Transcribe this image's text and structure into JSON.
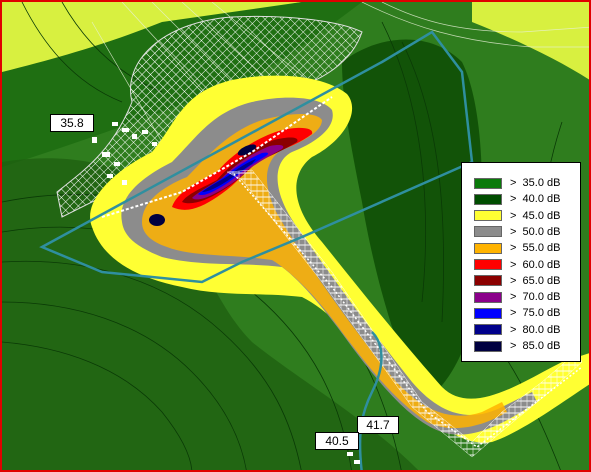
{
  "map": {
    "callouts": [
      {
        "id": "receiver-a",
        "text": "35.8"
      },
      {
        "id": "receiver-b",
        "text": "41.7"
      },
      {
        "id": "receiver-c",
        "text": "40.5"
      }
    ],
    "legend": {
      "items": [
        {
          "label": ">  35.0 dB",
          "color": "#0a7a0a"
        },
        {
          "label": ">  40.0 dB",
          "color": "#004d00"
        },
        {
          "label": ">  45.0 dB",
          "color": "#ffff33"
        },
        {
          "label": ">  50.0 dB",
          "color": "#8c8c8c"
        },
        {
          "label": ">  55.0 dB",
          "color": "#ffb300"
        },
        {
          "label": ">  60.0 dB",
          "color": "#ff0000"
        },
        {
          "label": ">  65.0 dB",
          "color": "#8b0000"
        },
        {
          "label": ">  70.0 dB",
          "color": "#8b008b"
        },
        {
          "label": ">  75.0 dB",
          "color": "#0000ff"
        },
        {
          "label": ">  80.0 dB",
          "color": "#00008b"
        },
        {
          "label": ">  85.0 dB",
          "color": "#000040"
        }
      ]
    },
    "colors": {
      "frame": "#e00000",
      "outer_light": "#d8f040",
      "ground": "#2f7d1e",
      "road_outline": "#2f8f9f",
      "hatch": "#ffffff"
    }
  }
}
